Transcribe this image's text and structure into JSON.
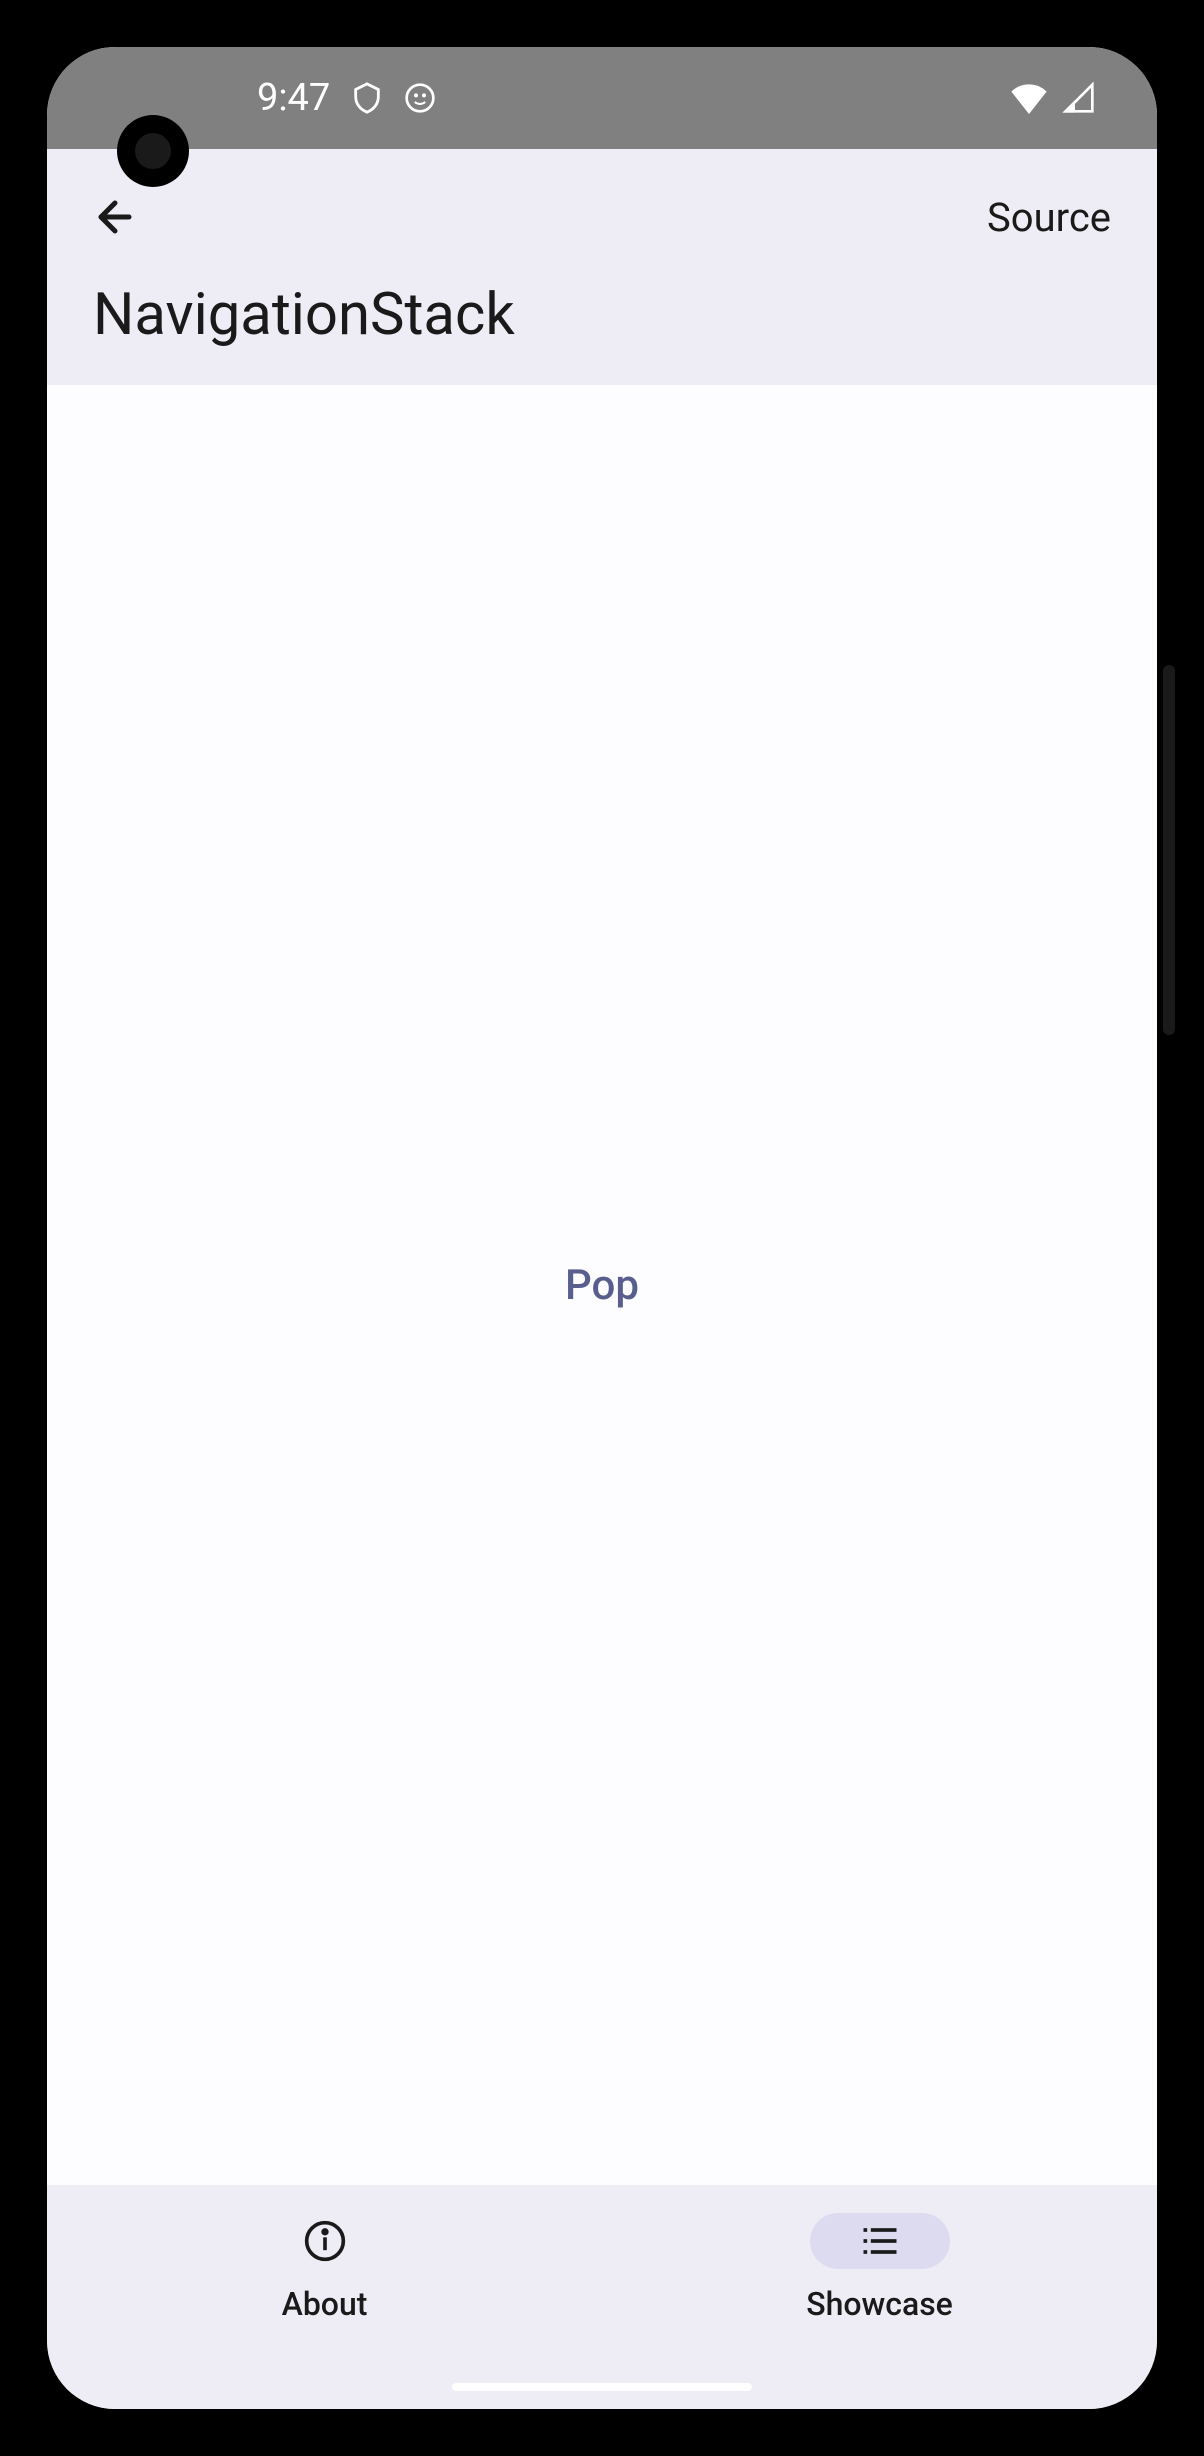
{
  "status": {
    "time": "9:47"
  },
  "appbar": {
    "source_label": "Source",
    "title": "NavigationStack"
  },
  "content": {
    "pop_label": "Pop"
  },
  "bottomnav": {
    "about_label": "About",
    "showcase_label": "Showcase"
  }
}
